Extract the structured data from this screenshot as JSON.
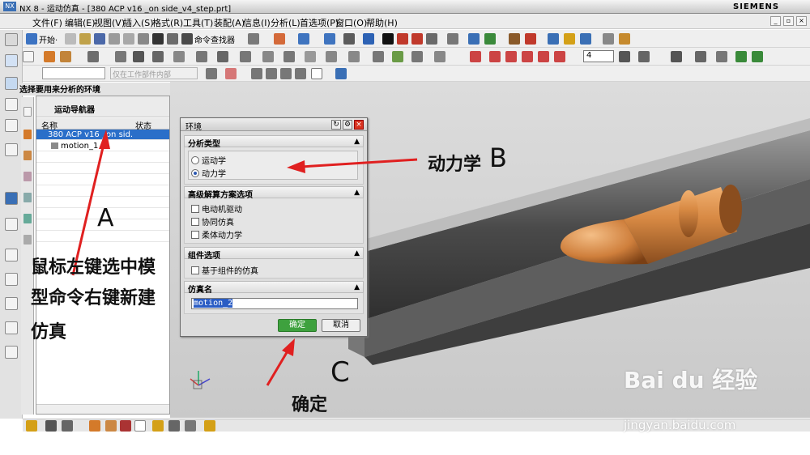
{
  "window": {
    "title": "NX 8 - 运动仿真 - [380 ACP v16 _on side_v4_step.prt]",
    "brand": "SIEMENS"
  },
  "menu": [
    "文件(F)",
    "编辑(E)",
    "视图(V)",
    "插入(S)",
    "格式(R)",
    "工具(T)",
    "装配(A)",
    "信息(I)",
    "分析(L)",
    "首选项(P)",
    "窗口(O)",
    "帮助(H)"
  ],
  "toolbar": {
    "start_label": "开始·",
    "command_finder": "命令查找器",
    "filter_placeholder": "仅在工作部件内部",
    "spin_value": "4"
  },
  "hint": "选择要用来分析的环境",
  "navigator": {
    "title": "运动导航器",
    "columns": [
      "名称",
      "状态"
    ],
    "rows": [
      {
        "name": "380 ACP v16 _on sid..."
      },
      {
        "name": "motion_1"
      }
    ]
  },
  "dialog": {
    "title": "环境",
    "section_analysis": "分析类型",
    "radio_kinematics": "运动学",
    "radio_dynamics": "动力学",
    "analysis_selected": "动力学",
    "section_advanced": "高级解算方案选项",
    "chk_motor": "电动机驱动",
    "chk_cosim": "协同仿真",
    "chk_flex": "柔体动力学",
    "section_component": "组件选项",
    "chk_component": "基于组件的仿真",
    "section_simname": "仿真名",
    "sim_name": "motion_2",
    "ok_label": "确定",
    "cancel_label": "取消"
  },
  "annotations": {
    "left_line1": "鼠标左键选中模",
    "left_line2": "型命令右键新建",
    "left_line3": "仿真",
    "letter_a": "A",
    "dynamics": "动力学",
    "letter_b": "B",
    "letter_c": "C",
    "confirm": "确定"
  },
  "watermark": {
    "brand": "Bai du 经验",
    "url": "jingyan.baidu.com"
  }
}
